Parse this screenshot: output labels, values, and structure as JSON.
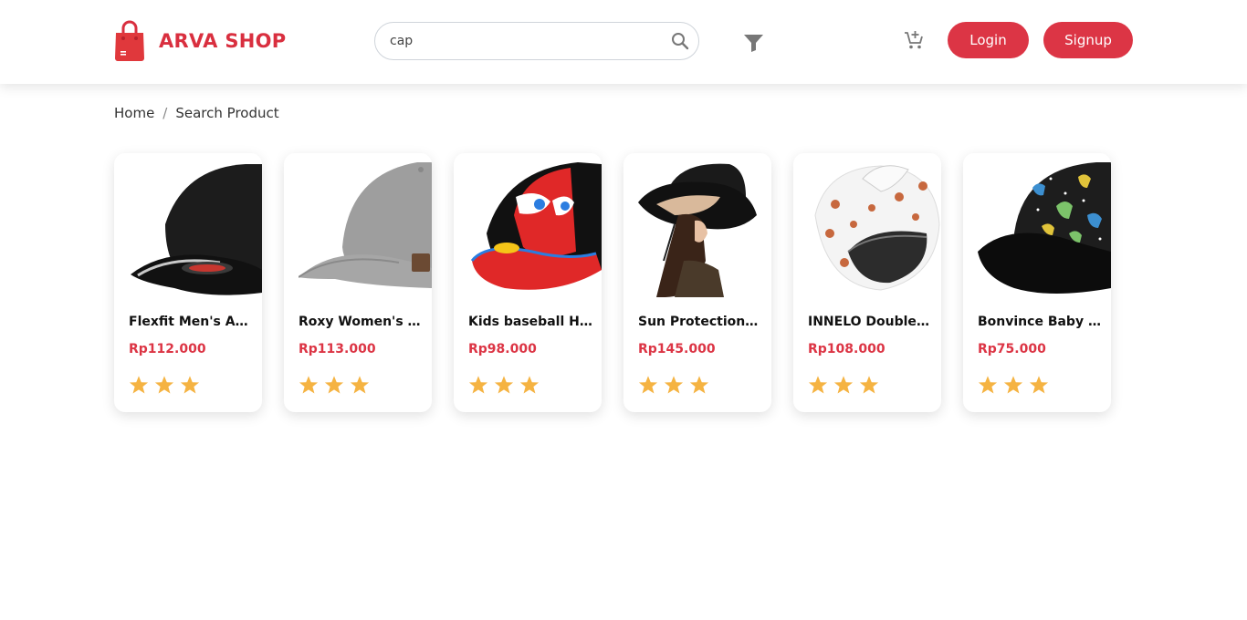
{
  "header": {
    "brand": "ARVA SHOP",
    "search": {
      "value": "cap",
      "placeholder": ""
    },
    "login_label": "Login",
    "signup_label": "Signup"
  },
  "breadcrumb": {
    "home": "Home",
    "current": "Search Product"
  },
  "colors": {
    "accent": "#dc3545",
    "star": "#f5b342"
  },
  "products": [
    {
      "name": "Flexfit Men's Athletic Baseball Fitted Cap",
      "price": "Rp112.000",
      "rating": 3,
      "image": "black-cap"
    },
    {
      "name": "Roxy Women's Extra Innings Baseball Hat",
      "price": "Rp113.000",
      "rating": 3,
      "image": "grey-cap"
    },
    {
      "name": "Kids baseball Hat Cars",
      "price": "Rp98.000",
      "rating": 3,
      "image": "red-cars-cap"
    },
    {
      "name": "Sun Protection Bucket Hat",
      "price": "Rp145.000",
      "rating": 3,
      "image": "woman-bucket-hat"
    },
    {
      "name": "INNELO Double Layer Satin Bonnet",
      "price": "Rp108.000",
      "rating": 3,
      "image": "polka-bonnet"
    },
    {
      "name": "Bonvince Baby Snapback Hat",
      "price": "Rp75.000",
      "rating": 3,
      "image": "dinosaur-snapback"
    }
  ]
}
